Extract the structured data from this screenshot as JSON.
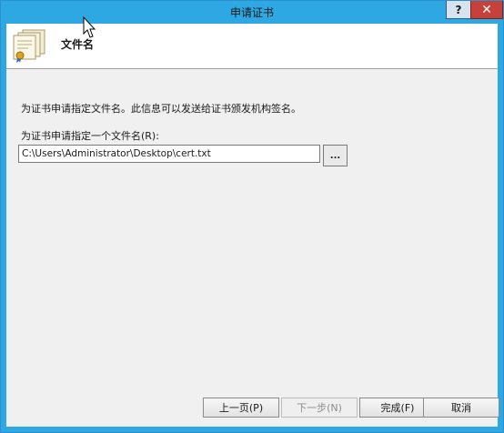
{
  "window": {
    "title": "申请证书",
    "help_label": "?",
    "close_label": "✕"
  },
  "header": {
    "icon": "certificate-icon",
    "title": "文件名"
  },
  "body": {
    "description": "为证书申请指定文件名。此信息可以发送给证书颁发机构签名。",
    "filename_label": "为证书申请指定一个文件名(R):",
    "filename_value": "C:\\Users\\Administrator\\Desktop\\cert.txt",
    "browse_label": "..."
  },
  "buttons": {
    "prev": "上一页(P)",
    "next": "下一步(N)",
    "finish": "完成(F)",
    "cancel": "取消"
  },
  "colors": {
    "titlebar": "#2da8e2",
    "close": "#c6413a",
    "client": "#f0f0f0"
  }
}
